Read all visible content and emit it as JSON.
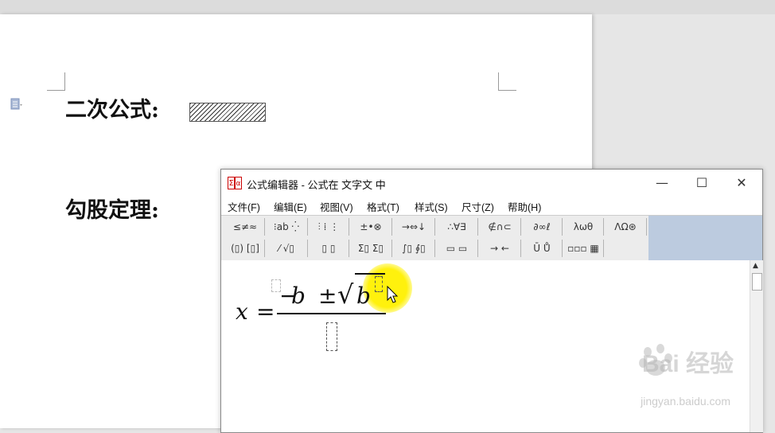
{
  "document": {
    "heading1": "二次公式:",
    "heading2": "勾股定理:"
  },
  "editor": {
    "title": "公式编辑器 - 公式在 文字文 中",
    "window_controls": {
      "minimize": "—",
      "maximize": "☐",
      "close": "✕"
    },
    "menu": [
      "文件(F)",
      "编辑(E)",
      "视图(V)",
      "格式(T)",
      "样式(S)",
      "尺寸(Z)",
      "帮助(H)"
    ],
    "toolbar_row1": [
      "≤≠≈",
      "⁝ab ⁛",
      "⫶ ⁞ ⋮",
      "±•⊗",
      "→⇔↓",
      "∴∀∃",
      "∉∩⊂",
      "∂∞ℓ",
      "λωθ",
      "ΛΩ⊛"
    ],
    "toolbar_row2": [
      "(▯) [▯]",
      "⁄ √▯",
      "▯ ▯",
      "Σ▯ Σ▯",
      "∫▯ ∮▯",
      "▭ ▭",
      "→ ←",
      "Ū Ů",
      "▫▫▫ ▦"
    ],
    "formula": {
      "lhs": "x",
      "equals": "=",
      "minus": "−",
      "b1": "b",
      "pm": "±",
      "radical": "√",
      "b2": "b"
    }
  },
  "watermark": {
    "main": "Bai 经验",
    "sub": "jingyan.baidu.com"
  }
}
